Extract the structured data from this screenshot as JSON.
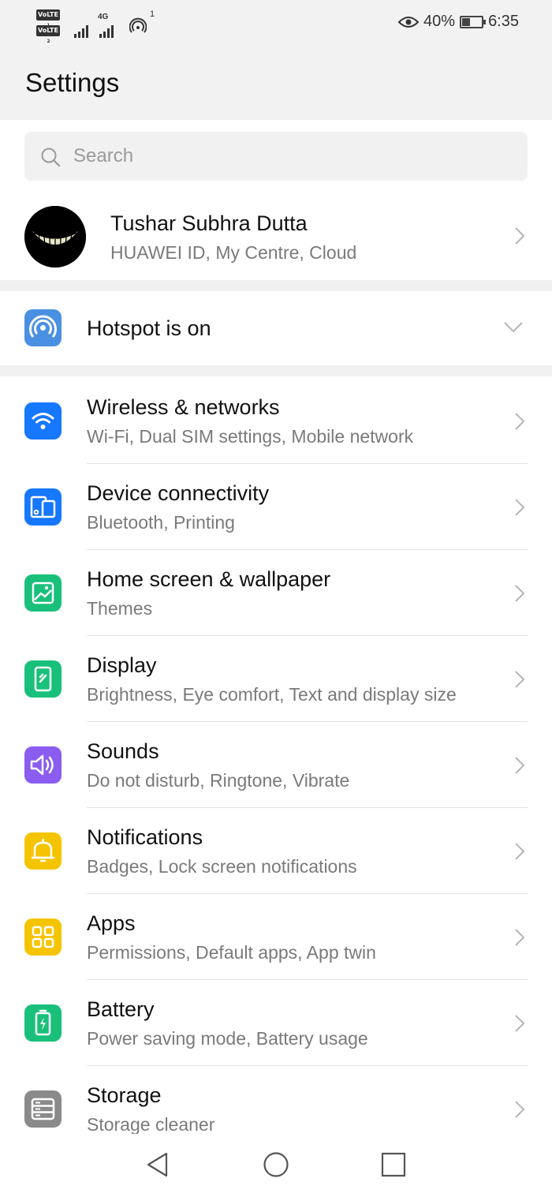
{
  "status_bar": {
    "volte_1": "VoLTE",
    "volte_2": "VoLTE",
    "sim_1": "1",
    "sim_2": "2",
    "network_type": "4G",
    "hotspot_count": "1",
    "battery_percent": "40%",
    "battery_level": 0.4,
    "time": "6:35"
  },
  "header": {
    "title": "Settings"
  },
  "search": {
    "placeholder": "Search"
  },
  "profile": {
    "name": "Tushar Subhra Dutta",
    "subtitle": "HUAWEI ID, My Centre, Cloud"
  },
  "hotspot": {
    "label": "Hotspot is on"
  },
  "items": [
    {
      "title": "Wireless & networks",
      "subtitle": "Wi-Fi, Dual SIM settings, Mobile network",
      "icon": "wifi-icon",
      "color": "#1677ff"
    },
    {
      "title": "Device connectivity",
      "subtitle": "Bluetooth, Printing",
      "icon": "device-connectivity-icon",
      "color": "#1677ff"
    },
    {
      "title": "Home screen & wallpaper",
      "subtitle": "Themes",
      "icon": "wallpaper-icon",
      "color": "#19c07a"
    },
    {
      "title": "Display",
      "subtitle": "Brightness, Eye comfort, Text and display size",
      "icon": "display-icon",
      "color": "#19c07a"
    },
    {
      "title": "Sounds",
      "subtitle": "Do not disturb, Ringtone, Vibrate",
      "icon": "speaker-icon",
      "color": "#8a5cf0"
    },
    {
      "title": "Notifications",
      "subtitle": "Badges, Lock screen notifications",
      "icon": "bell-icon",
      "color": "#f5c400"
    },
    {
      "title": "Apps",
      "subtitle": "Permissions, Default apps, App twin",
      "icon": "apps-grid-icon",
      "color": "#f5c400"
    },
    {
      "title": "Battery",
      "subtitle": "Power saving mode, Battery usage",
      "icon": "battery-icon",
      "color": "#19c07a"
    },
    {
      "title": "Storage",
      "subtitle": "Storage cleaner",
      "icon": "storage-icon",
      "color": "#8a8a8a"
    }
  ]
}
